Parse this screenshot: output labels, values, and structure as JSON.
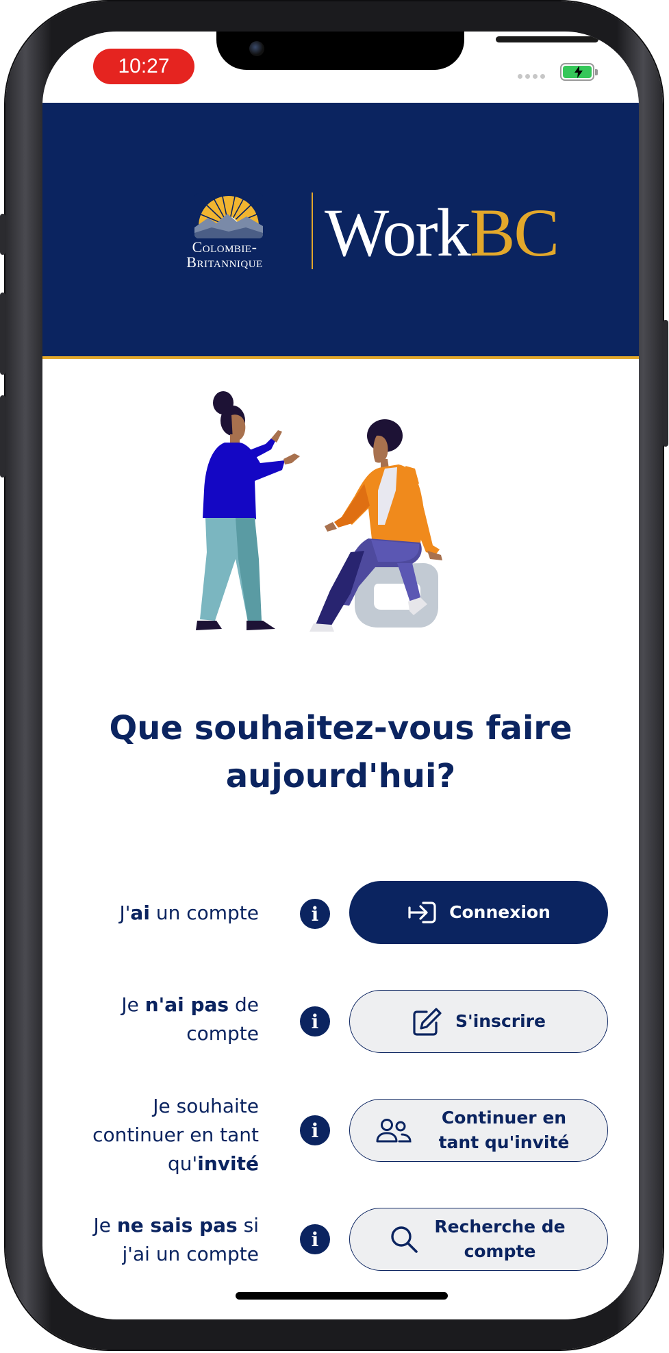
{
  "status_bar": {
    "time": "10:27",
    "battery_color": "#35c759",
    "time_pill_color": "#e52420"
  },
  "header": {
    "province_logo_line1": "Colombie-",
    "province_logo_line2": "Britannique",
    "brand_work": "Work",
    "brand_bc": "BC",
    "background_color": "#0b2460",
    "accent_color": "#e3a82b"
  },
  "main": {
    "heading": "Que souhaitez-vous faire aujourd'hui?",
    "options": [
      {
        "label_html": "J'<b>ai</b> un compte",
        "button_label": "Connexion",
        "icon": "login-arrow-icon",
        "style": "primary"
      },
      {
        "label_html": "Je <b>n'ai pas</b> de compte",
        "button_label": "S'inscrire",
        "icon": "edit-pencil-icon",
        "style": "secondary"
      },
      {
        "label_html": "Je souhaite continuer en tant qu'<b>invité</b>",
        "button_label": "Continuer en tant qu'invité",
        "icon": "users-icon",
        "style": "secondary"
      },
      {
        "label_html": "Je <b>ne sais pas</b> si j'ai un compte",
        "button_label": "Recherche de compte",
        "icon": "search-icon",
        "style": "secondary"
      }
    ]
  }
}
